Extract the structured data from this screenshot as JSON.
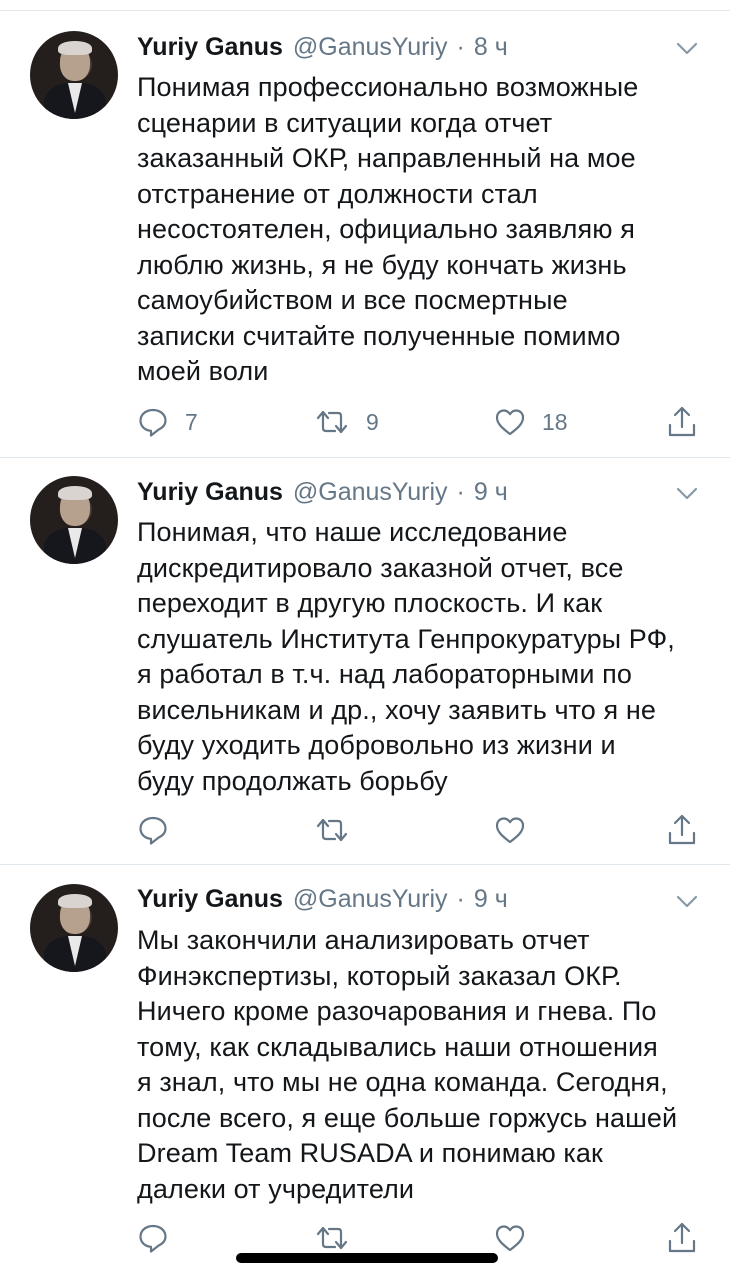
{
  "tweets": [
    {
      "author_name": "Yuriy Ganus",
      "handle": "@GanusYuriy",
      "separator": "·",
      "time": "8 ч",
      "text": "Понимая профессионально возможные\nсценарии в ситуации когда отчет\nзаказанный ОКР, направленный на мое\nотстранение от должности стал\nнесостоятелен, официально заявляю я\nлюблю жизнь, я не буду кончать жизнь\nсамоубийством и все посмертные\nзаписки считайте полученные помимо\nмоей воли",
      "replies": "7",
      "retweets": "9",
      "likes": "18"
    },
    {
      "author_name": "Yuriy Ganus",
      "handle": "@GanusYuriy",
      "separator": "·",
      "time": "9 ч",
      "text": "Понимая, что наше исследование\nдискредитировало заказной отчет, все\nпереходит в другую плоскость. И как\nслушатель Института Генпрокуратуры РФ,\nя работал в т.ч. над лабораторными по\nвисельникам и др., хочу заявить что я не\nбуду уходить добровольно из жизни и\nбуду продолжать борьбу",
      "replies": "",
      "retweets": "",
      "likes": ""
    },
    {
      "author_name": "Yuriy Ganus",
      "handle": "@GanusYuriy",
      "separator": "·",
      "time": "9 ч",
      "text": "Мы закончили анализировать отчет\nФинэкспертизы, который заказал ОКР.\nНичего кроме разочарования и гнева. По\nтому, как складывались наши отношения\nя знал, что мы не одна команда. Сегодня,\nпосле всего, я еще больше горжусь нашей\nDream Team RUSADA и понимаю как\nдалеки от учредители",
      "replies": "",
      "retweets": "",
      "likes": ""
    }
  ],
  "icons": {
    "reply": "reply-icon",
    "retweet": "retweet-icon",
    "like": "like-icon",
    "share": "share-icon",
    "menu": "chevron-down-icon",
    "avatar": "avatar"
  },
  "colors": {
    "text": "#14171a",
    "secondary": "#657786",
    "divider": "#e1e8ed"
  }
}
